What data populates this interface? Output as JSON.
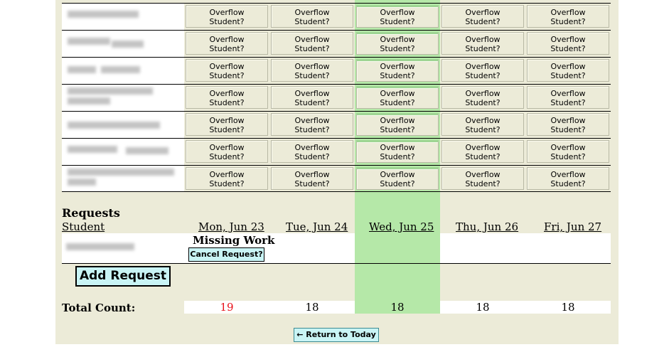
{
  "days": [
    {
      "label": "Mon, Jun 23"
    },
    {
      "label": "Tue, Jun 24"
    },
    {
      "label": "Wed, Jun 25"
    },
    {
      "label": "Thu, Jun 26"
    },
    {
      "label": "Fri, Jun 27"
    }
  ],
  "grid": {
    "overflow_label": "Overflow Student?",
    "row_count": 7
  },
  "requests": {
    "title": "Requests",
    "student_col": "Student",
    "entry": {
      "type_label": "Missing Work",
      "cancel_label": "Cancel Request?"
    },
    "add_label": "Add Request"
  },
  "totals": {
    "label": "Total Count:",
    "values": [
      "19",
      "18",
      "18",
      "18",
      "18"
    ]
  },
  "nav": {
    "return_label": "← Return to Today"
  },
  "colors": {
    "panel": "#ecebd8",
    "today": "#b5e8a8",
    "button": "#c9f4f5",
    "over_count": "#e8121a"
  }
}
